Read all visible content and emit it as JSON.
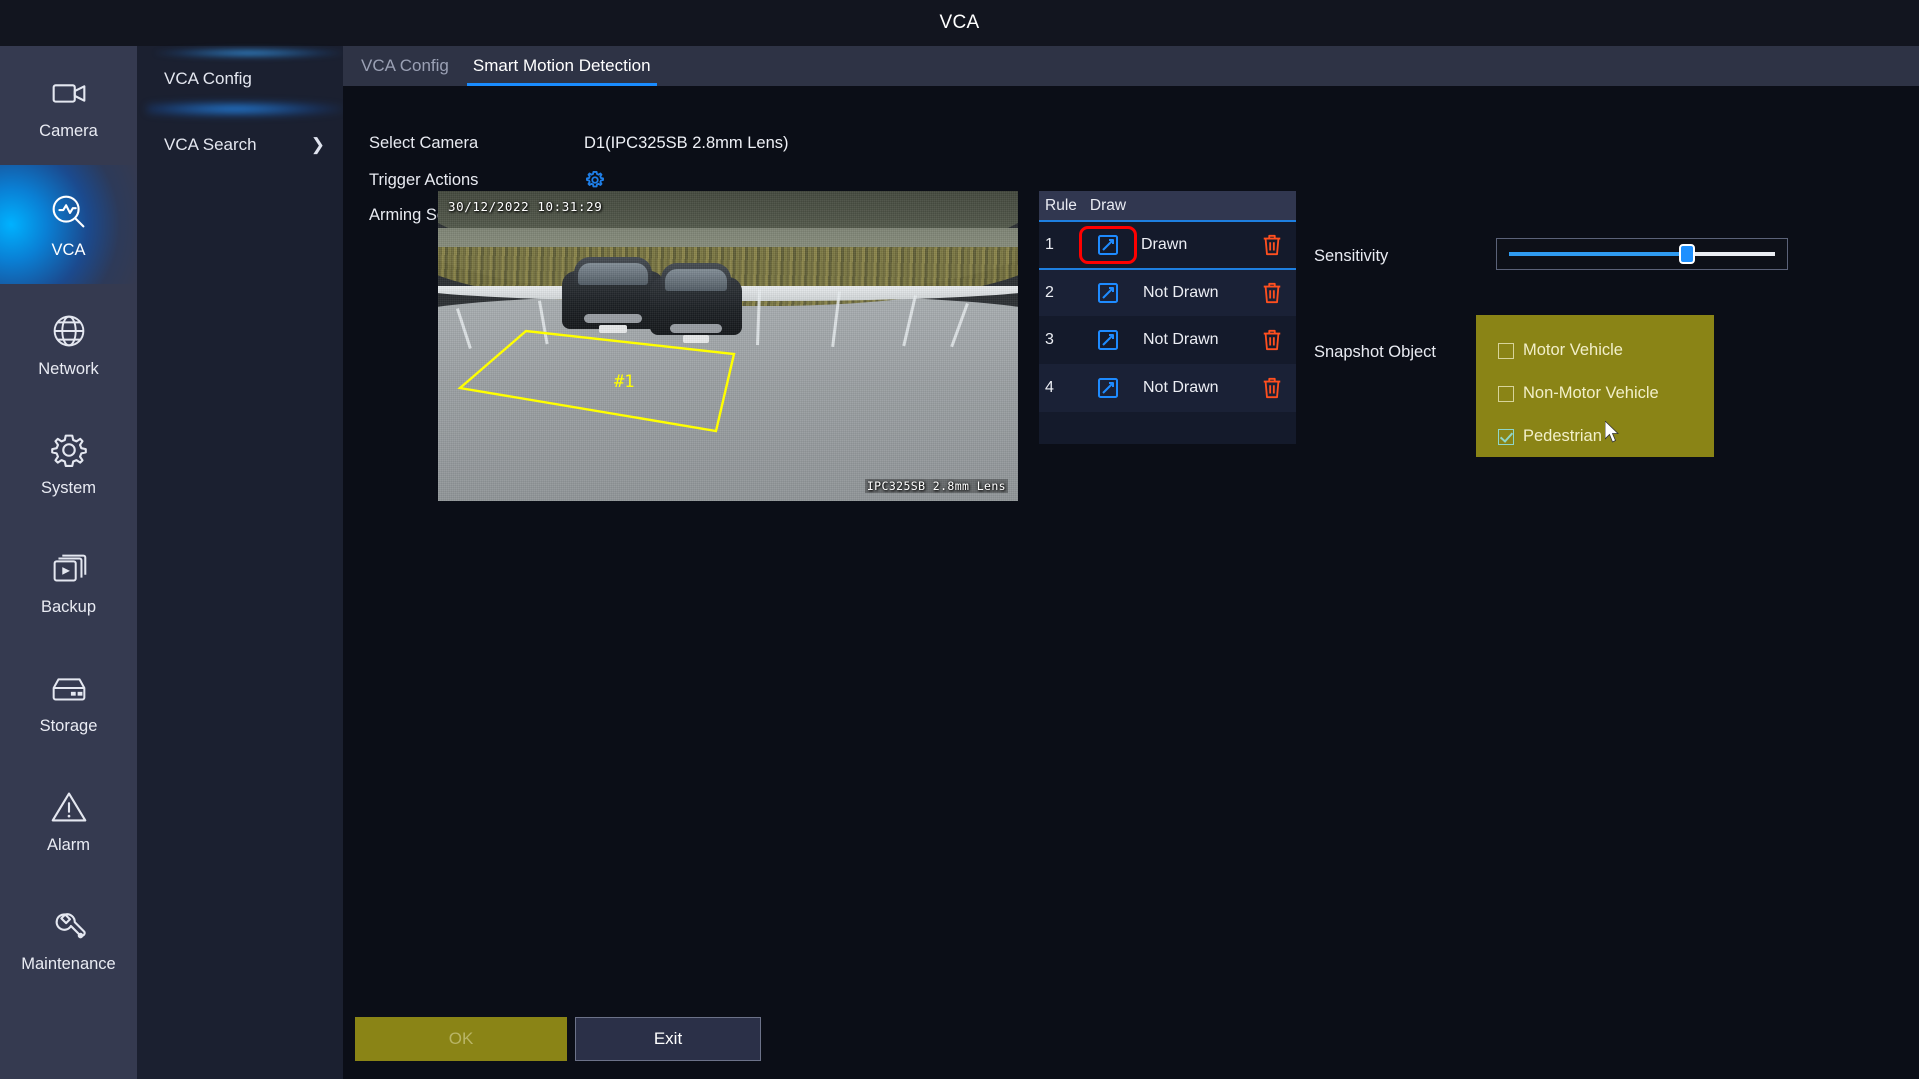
{
  "window": {
    "title": "VCA"
  },
  "rail": {
    "items": [
      {
        "label": "Camera",
        "icon": "camera-icon",
        "active": false
      },
      {
        "label": "VCA",
        "icon": "vca-icon",
        "active": true
      },
      {
        "label": "Network",
        "icon": "globe-icon",
        "active": false
      },
      {
        "label": "System",
        "icon": "gear-icon",
        "active": false
      },
      {
        "label": "Backup",
        "icon": "backup-icon",
        "active": false
      },
      {
        "label": "Storage",
        "icon": "storage-icon",
        "active": false
      },
      {
        "label": "Alarm",
        "icon": "alarm-icon",
        "active": false
      },
      {
        "label": "Maintenance",
        "icon": "wrench-icon",
        "active": false
      }
    ]
  },
  "submenu": {
    "items": [
      {
        "label": "VCA Config",
        "selected": true,
        "chevron": ""
      },
      {
        "label": "VCA Search",
        "selected": false,
        "chevron": "❯"
      }
    ]
  },
  "tabs": [
    {
      "label": "VCA Config",
      "active": false
    },
    {
      "label": "Smart Motion Detection",
      "active": true
    }
  ],
  "form": {
    "select_camera_label": "Select Camera",
    "select_camera_value": "D1(IPC325SB 2.8mm Lens)",
    "trigger_actions_label": "Trigger Actions",
    "arming_schedule_label": "Arming Schedule"
  },
  "preview": {
    "timestamp": "30/12/2022 10:31:29",
    "camera_overlay": "IPC325SB 2.8mm Lens",
    "region_label": "#1",
    "region_color": "#ffff00"
  },
  "rule_table": {
    "headers": [
      "Rule",
      "Draw",
      "",
      ""
    ],
    "rows": [
      {
        "rule": "1",
        "state": "Drawn",
        "highlighted": true
      },
      {
        "rule": "2",
        "state": "Not Drawn",
        "highlighted": false
      },
      {
        "rule": "3",
        "state": "Not Drawn",
        "highlighted": false
      },
      {
        "rule": "4",
        "state": "Not Drawn",
        "highlighted": false
      }
    ]
  },
  "sensitivity": {
    "label": "Sensitivity",
    "value_percent": 67
  },
  "snapshot_object": {
    "label": "Snapshot Object",
    "options": [
      {
        "label": "Motor Vehicle",
        "checked": false
      },
      {
        "label": "Non-Motor Vehicle",
        "checked": false
      },
      {
        "label": "Pedestrian",
        "checked": true
      }
    ]
  },
  "footer": {
    "ok_label": "OK",
    "exit_label": "Exit"
  },
  "colors": {
    "accent_blue": "#1a8cff",
    "olive": "#8a8416",
    "highlight_red": "#ff0000",
    "trash_orange": "#ff4f1f",
    "region_yellow": "#ffff00"
  }
}
